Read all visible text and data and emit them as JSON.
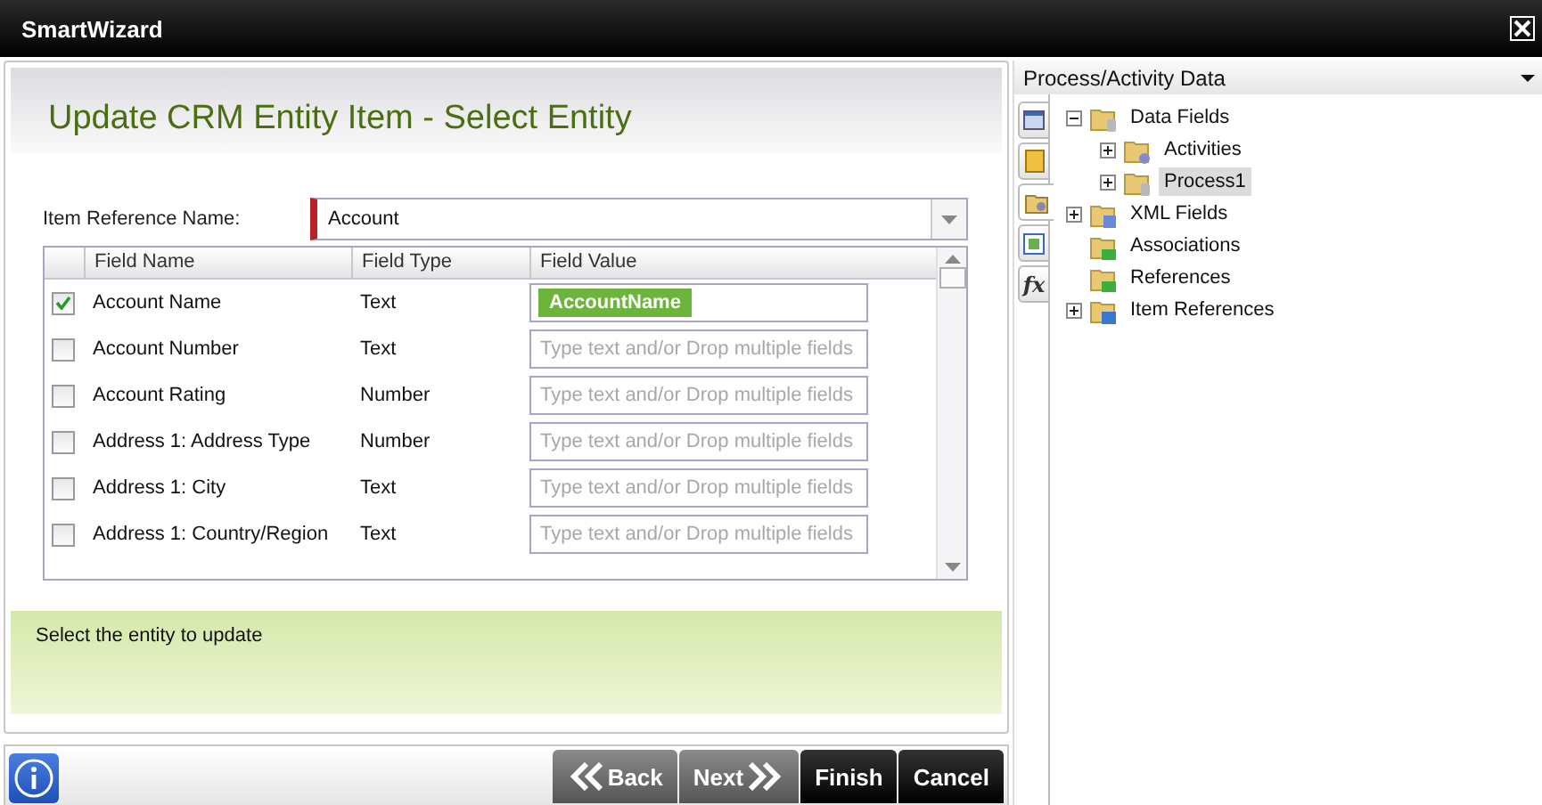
{
  "window": {
    "title": "SmartWizard"
  },
  "wizard": {
    "heading": "Update CRM Entity Item - Select Entity",
    "item_reference": {
      "label": "Item Reference Name:",
      "value": "Account"
    },
    "table": {
      "columns": [
        "Field Name",
        "Field Type",
        "Field Value"
      ],
      "rows": [
        {
          "checked": true,
          "name": "Account Name",
          "type": "Text",
          "value": "AccountName"
        },
        {
          "checked": false,
          "name": "Account Number",
          "type": "Text",
          "placeholder": "Type text and/or Drop multiple fields"
        },
        {
          "checked": false,
          "name": "Account Rating",
          "type": "Number",
          "placeholder": "Type text and/or Drop multiple fields"
        },
        {
          "checked": false,
          "name": "Address 1: Address Type",
          "type": "Number",
          "placeholder": "Type text and/or Drop multiple fields"
        },
        {
          "checked": false,
          "name": "Address 1: City",
          "type": "Text",
          "placeholder": "Type text and/or Drop multiple fields"
        },
        {
          "checked": false,
          "name": "Address 1: Country/Region",
          "type": "Text",
          "placeholder": "Type text and/or Drop multiple fields"
        }
      ]
    },
    "description": "Select the entity to update",
    "buttons": [
      {
        "kind": "back",
        "label": "Back"
      },
      {
        "kind": "next",
        "label": "Next"
      },
      {
        "kind": "plain",
        "label": "Finish"
      },
      {
        "kind": "plain",
        "label": "Cancel"
      }
    ]
  },
  "side_panel": {
    "title": "Process/Activity Data",
    "tabs": [
      {
        "kind": "window",
        "selected": false
      },
      {
        "kind": "notebook",
        "selected": false
      },
      {
        "kind": "folder",
        "selected": true
      },
      {
        "kind": "form",
        "selected": false
      },
      {
        "kind": "text",
        "label": "fx",
        "selected": false
      }
    ],
    "tree": [
      {
        "label": "Data Fields",
        "kind": "database",
        "expanded": true,
        "selected": false,
        "children": [
          {
            "label": "Activities",
            "kind": "gear",
            "expanded": false,
            "selected": false
          },
          {
            "label": "Process1",
            "kind": "database",
            "expanded": false,
            "selected": true
          }
        ]
      },
      {
        "label": "XML Fields",
        "kind": "xml",
        "expanded": false,
        "selected": false
      },
      {
        "label": "Associations",
        "kind": "link"
      },
      {
        "label": "References",
        "kind": "link"
      },
      {
        "label": "Item References",
        "kind": "ref",
        "expanded": false,
        "selected": false
      }
    ]
  }
}
